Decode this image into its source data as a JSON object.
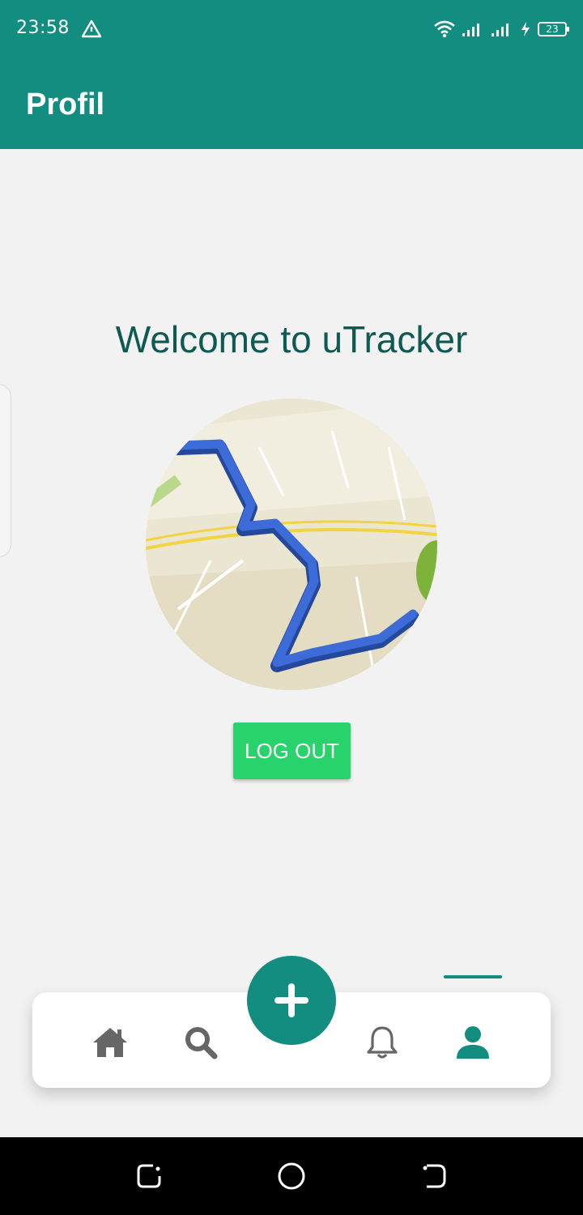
{
  "status_bar": {
    "time": "23:58",
    "battery_level": "23",
    "icons": [
      "alert-triangle-icon",
      "wifi-icon",
      "signal-icon",
      "signal-icon",
      "charging-icon",
      "battery-icon"
    ]
  },
  "app_bar": {
    "title": "Profil"
  },
  "main": {
    "welcome_text": "Welcome to uTracker",
    "avatar_image": "route-map-icon",
    "logout_label": "LOG OUT"
  },
  "bottom_nav": {
    "items": [
      {
        "icon": "home-icon"
      },
      {
        "icon": "search-icon"
      },
      {
        "icon": "plus-icon"
      },
      {
        "icon": "bell-icon"
      },
      {
        "icon": "user-icon"
      }
    ],
    "active_item": "user-icon"
  },
  "system_nav": {
    "buttons": [
      "recents-icon",
      "home-circle-icon",
      "back-icon"
    ]
  },
  "colors": {
    "primary": "#138d80",
    "accent_green": "#27d36a",
    "welcome_text": "#0e5a53",
    "background": "#f2f2f2",
    "nav_inactive": "#666666"
  }
}
